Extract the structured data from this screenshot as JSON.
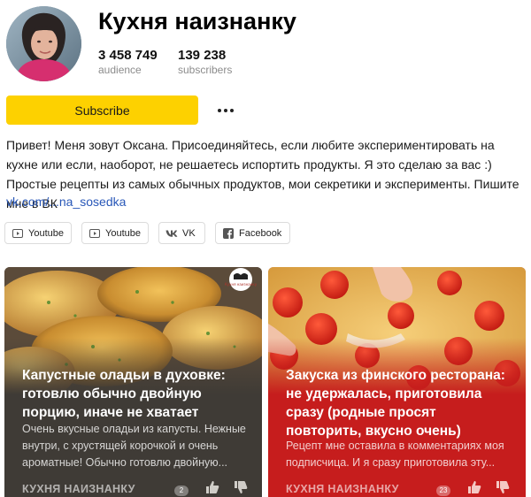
{
  "channel": {
    "title": "Кухня наизнанку",
    "stats": [
      {
        "value": "3 458 749",
        "label": "audience"
      },
      {
        "value": "139 238",
        "label": "subscribers"
      }
    ]
  },
  "actions": {
    "subscribe_label": "Subscribe"
  },
  "description": {
    "text": "Привет! Меня зовут Оксана. Присоединяйтесь, если любите экспериментировать на кухне или если, наоборот, не решаетесь испортить продукты. Я это сделаю за вас :) Простые рецепты из самых обычных продуктов, мои секретики и эксперименты. Пишите мне в ВК",
    "link": "vk.com/...na_sosedka"
  },
  "social_links": [
    {
      "label": "Youtube",
      "icon": "youtube-icon"
    },
    {
      "label": "Youtube",
      "icon": "youtube-icon"
    },
    {
      "label": "VK",
      "icon": "vk-icon"
    },
    {
      "label": "Facebook",
      "icon": "facebook-icon"
    }
  ],
  "cards": [
    {
      "title": "Капустные оладьи в духовке: готовлю обычно двойную порцию, иначе не хватает",
      "snippet": "Очень вкусные оладьи из капусты. Нежные внутри, с хрустящей корочкой и очень ароматные! Обычно готовлю двойную...",
      "source": "КУХНЯ НАИЗНАНКУ",
      "comments": "2",
      "logo_text": "Кухня наизнанку",
      "icons": [
        "like-icon",
        "dislike-icon",
        "comments-icon"
      ]
    },
    {
      "title": "Закуска из финского ресторана: не удержалась, приготовила сразу (родные просят повторить, вкусно очень)",
      "snippet": "Рецепт мне оставила в комментариях моя подписчица. И я сразу приготовила эту...",
      "source": "КУХНЯ НАИЗНАНКУ",
      "comments": "23",
      "icons": [
        "like-icon",
        "dislike-icon",
        "comments-icon"
      ]
    }
  ],
  "colors": {
    "accent_yellow": "#fdd100",
    "link_blue": "#2857b8",
    "card2_bg": "#c61d1d"
  }
}
